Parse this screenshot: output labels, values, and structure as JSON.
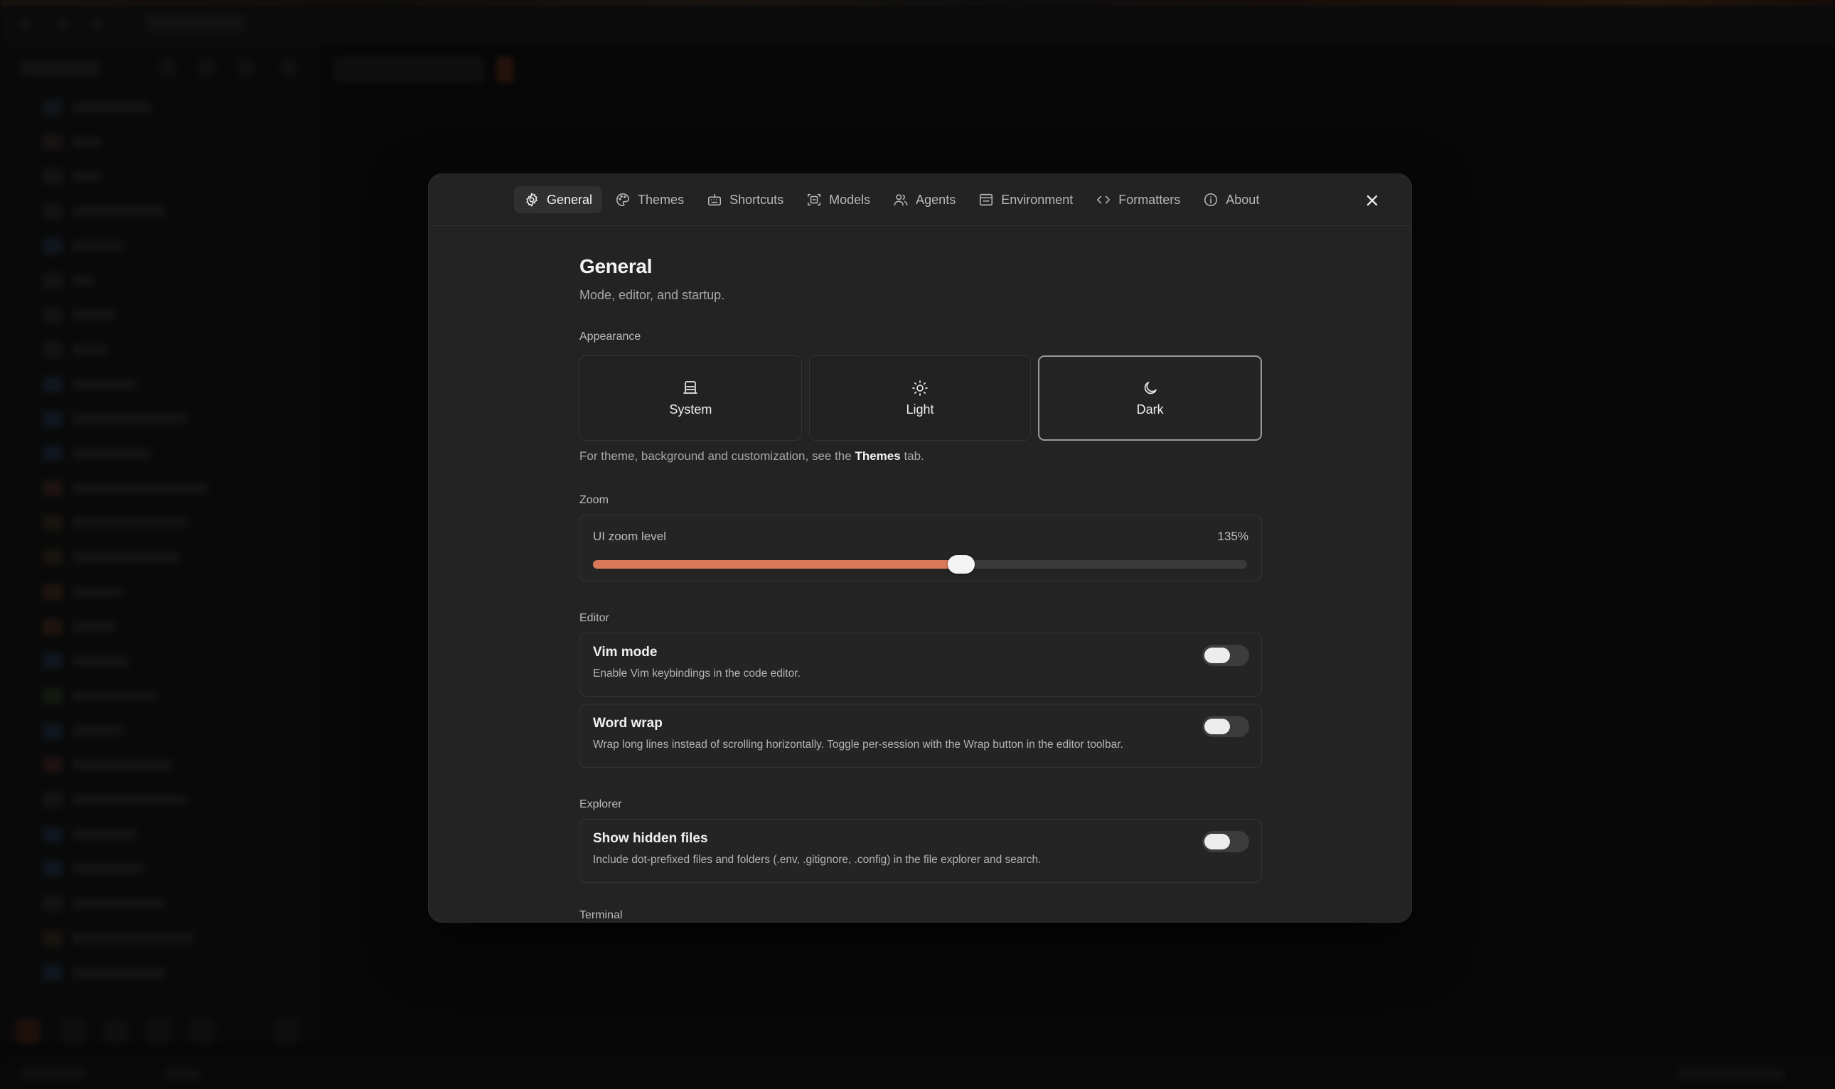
{
  "settings": {
    "tabs": [
      {
        "id": "general",
        "label": "General",
        "icon": "gear-icon",
        "active": true
      },
      {
        "id": "themes",
        "label": "Themes",
        "icon": "palette-icon",
        "active": false
      },
      {
        "id": "shortcuts",
        "label": "Shortcuts",
        "icon": "keyboard-icon",
        "active": false
      },
      {
        "id": "models",
        "label": "Models",
        "icon": "models-icon",
        "active": false
      },
      {
        "id": "agents",
        "label": "Agents",
        "icon": "users-icon",
        "active": false
      },
      {
        "id": "environment",
        "label": "Environment",
        "icon": "environment-icon",
        "active": false
      },
      {
        "id": "formatters",
        "label": "Formatters",
        "icon": "code-icon",
        "active": false
      },
      {
        "id": "about",
        "label": "About",
        "icon": "info-icon",
        "active": false
      }
    ],
    "close_icon": "close-icon"
  },
  "general": {
    "title": "General",
    "subtitle": "Mode, editor, and startup.",
    "appearance": {
      "heading": "Appearance",
      "options": [
        {
          "label": "System",
          "icon": "monitor-icon",
          "selected": false
        },
        {
          "label": "Light",
          "icon": "sun-icon",
          "selected": false
        },
        {
          "label": "Dark",
          "icon": "moon-icon",
          "selected": true
        }
      ],
      "hint_before": "For theme, background and customization, see the",
      "hint_link": "Themes",
      "hint_after": "tab."
    },
    "zoom": {
      "heading": "Zoom",
      "label": "UI zoom level",
      "value_text": "135%",
      "fill_fraction": 0.563,
      "accent_color": "#d9775a"
    },
    "editor": {
      "heading": "Editor",
      "vim_mode": {
        "title": "Vim mode",
        "description": "Enable Vim keybindings in the code editor.",
        "enabled": false
      },
      "word_wrap": {
        "title": "Word wrap",
        "description": "Wrap long lines instead of scrolling horizontally. Toggle per-session with the Wrap button in the editor toolbar.",
        "enabled": false
      }
    },
    "explorer": {
      "heading": "Explorer",
      "show_hidden": {
        "title": "Show hidden files",
        "description": "Include dot-prefixed files and folders (.env, .gitignore, .config) in the file explorer and search.",
        "enabled": false
      }
    },
    "terminal": {
      "heading": "Terminal"
    }
  }
}
